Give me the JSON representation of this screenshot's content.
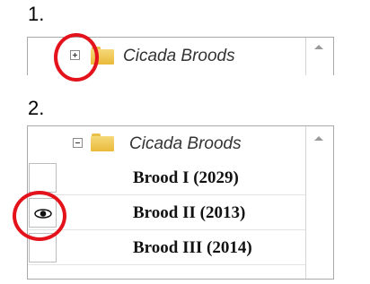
{
  "steps": [
    {
      "number": "1."
    },
    {
      "number": "2."
    }
  ],
  "tree": {
    "folder_name": "Cicada Broods",
    "layers": [
      {
        "name": "Brood I (2029)",
        "visible": false
      },
      {
        "name": "Brood II (2013)",
        "visible": true
      },
      {
        "name": "Brood III (2014)",
        "visible": false
      }
    ]
  },
  "icons": {
    "expand": "plus-box-icon",
    "collapse": "minus-box-icon",
    "folder": "folder-icon",
    "visibility": "eye-icon",
    "scroll_up": "chevron-up-icon"
  },
  "colors": {
    "highlight_circle": "#e3121b",
    "folder": "#f0cc5c"
  }
}
